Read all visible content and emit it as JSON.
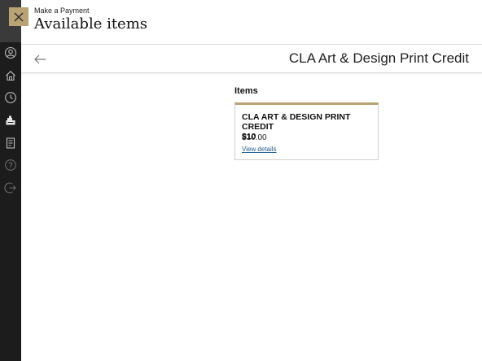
{
  "header": {
    "eyebrow": "Make a Payment",
    "title": "Available items"
  },
  "subbar": {
    "subtitle": "CLA Art & Design Print Credit"
  },
  "items": {
    "section_label": "Items",
    "card": {
      "name_line1": "CLA ART & DESIGN PRINT CREDIT",
      "name_line2": "$10",
      "price": "$10.00",
      "link": "View details"
    }
  },
  "sidebar": {
    "icons": [
      "user-circle-icon",
      "home-icon",
      "clock-icon",
      "cash-register-icon",
      "receipt-icon",
      "help-icon",
      "logout-icon"
    ]
  },
  "colors": {
    "accent": "#b9a374",
    "sidebar": "#1c1c1c",
    "link": "#1f5a8a"
  }
}
